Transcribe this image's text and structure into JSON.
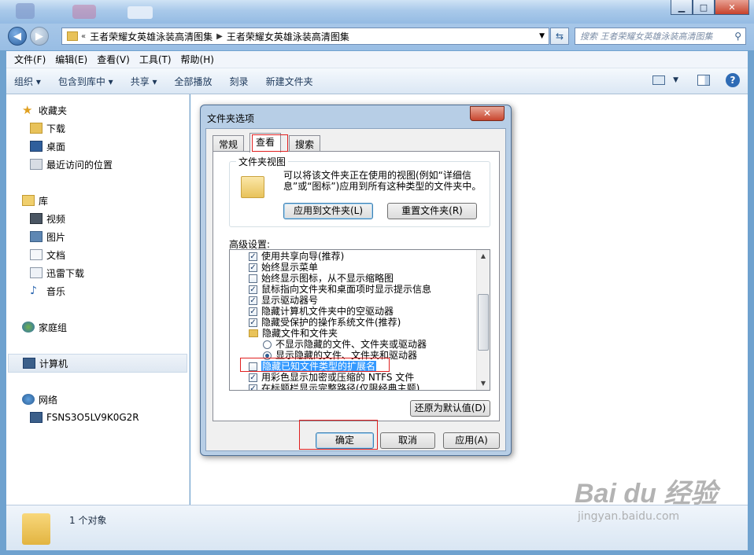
{
  "explorer": {
    "breadcrumb_prefix": "«",
    "breadcrumb": [
      "王者荣耀女英雄泳装高清图集",
      "王者荣耀女英雄泳装高清图集"
    ],
    "search_placeholder": "搜索 王者荣耀女英雄泳装高清图集",
    "window_controls": {
      "minimize": "▁",
      "maximize": "□",
      "close": "✕"
    },
    "menu": [
      "文件(F)",
      "编辑(E)",
      "查看(V)",
      "工具(T)",
      "帮助(H)"
    ],
    "toolbar": [
      "组织 ▾",
      "包含到库中 ▾",
      "共享 ▾",
      "全部播放",
      "刻录",
      "新建文件夹"
    ],
    "nav": {
      "favorites": "收藏夹",
      "downloads": "下载",
      "desktop": "桌面",
      "recent": "最近访问的位置",
      "libraries": "库",
      "videos": "视频",
      "pictures": "图片",
      "documents": "文档",
      "xunlei": "迅雷下载",
      "music": "音乐",
      "homegroup": "家庭组",
      "computer": "计算机",
      "network": "网络",
      "pc": "FSNS3O5LV9K0G2R"
    },
    "status": "1 个对象",
    "watermark": {
      "logo": "Bai du 经验",
      "url": "jingyan.baidu.com"
    }
  },
  "dialog": {
    "title": "文件夹选项",
    "close": "✕",
    "tabs": [
      "常规",
      "查看",
      "搜索"
    ],
    "active_tab": "查看",
    "folder_views": {
      "title": "文件夹视图",
      "description": "可以将该文件夹正在使用的视图(例如“详细信息”或“图标”)应用到所有这种类型的文件夹中。",
      "apply_button": "应用到文件夹(L)",
      "reset_button": "重置文件夹(R)"
    },
    "advanced_label": "高级设置:",
    "settings": [
      {
        "type": "checkbox",
        "checked": true,
        "label": "使用共享向导(推荐)"
      },
      {
        "type": "checkbox",
        "checked": true,
        "label": "始终显示菜单"
      },
      {
        "type": "checkbox",
        "checked": false,
        "label": "始终显示图标，从不显示缩略图"
      },
      {
        "type": "checkbox",
        "checked": true,
        "label": "鼠标指向文件夹和桌面项时显示提示信息"
      },
      {
        "type": "checkbox",
        "checked": true,
        "label": "显示驱动器号"
      },
      {
        "type": "checkbox",
        "checked": true,
        "label": "隐藏计算机文件夹中的空驱动器"
      },
      {
        "type": "checkbox",
        "checked": true,
        "label": "隐藏受保护的操作系统文件(推荐)"
      },
      {
        "type": "folder",
        "label": "隐藏文件和文件夹"
      },
      {
        "type": "radio",
        "checked": false,
        "label": "不显示隐藏的文件、文件夹或驱动器"
      },
      {
        "type": "radio",
        "checked": true,
        "label": "显示隐藏的文件、文件夹和驱动器"
      },
      {
        "type": "checkbox",
        "checked": false,
        "label": "隐藏已知文件类型的扩展名",
        "highlight": true
      },
      {
        "type": "checkbox",
        "checked": true,
        "label": "用彩色显示加密或压缩的 NTFS 文件"
      },
      {
        "type": "checkbox",
        "checked": true,
        "label": "在标题栏显示完整路径(仅限经典主题)"
      }
    ],
    "restore_button": "还原为默认值(D)",
    "ok_button": "确定",
    "cancel_button": "取消",
    "apply_button": "应用(A)"
  }
}
